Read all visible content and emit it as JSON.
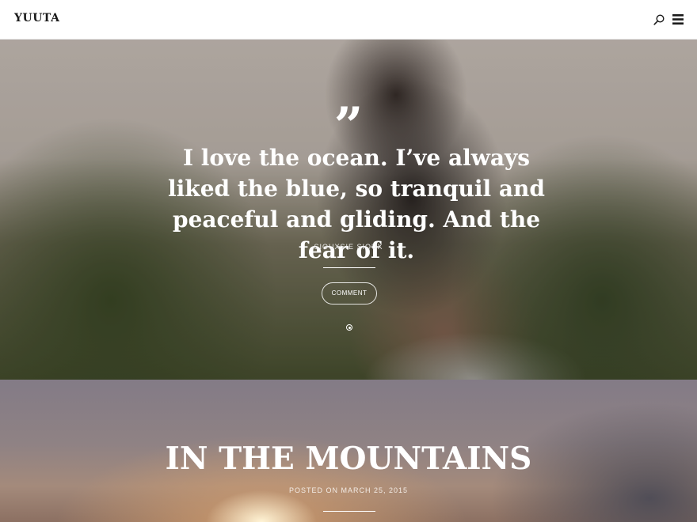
{
  "header": {
    "site_title": "YUUTA",
    "search_icon": "search-icon",
    "menu_icon": "hamburger-menu-icon"
  },
  "hero": {
    "quote_mark": "”",
    "quote": "I love the ocean. I’ve always liked the blue, so tranquil and peaceful and gliding. And the fear of it.",
    "author": "SIOUXSIE SIOUX",
    "comment_label": "COMMENT",
    "slider": {
      "active_index": 0,
      "count": 1
    }
  },
  "post": {
    "title": "IN THE MOUNTAINS",
    "meta": "POSTED ON MARCH 25, 2015"
  },
  "colors": {
    "header_bg": "#ffffff",
    "title_text": "#1b1b1b",
    "hero_text": "#ffffff"
  }
}
